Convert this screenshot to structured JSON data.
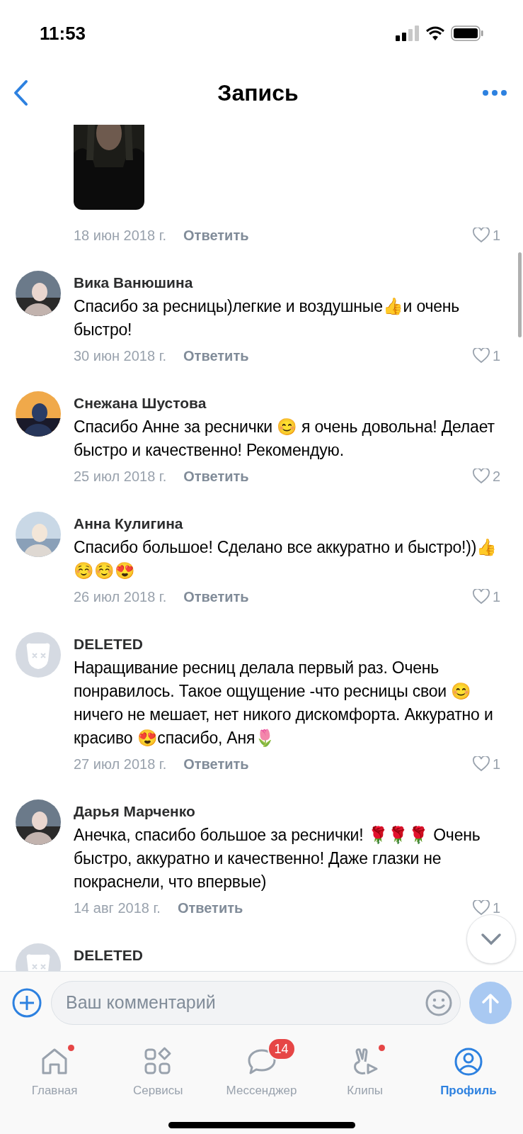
{
  "status_bar": {
    "time": "11:53"
  },
  "header": {
    "title": "Запись"
  },
  "top_comment": {
    "date": "18 июн 2018 г.",
    "reply": "Ответить",
    "likes": "1"
  },
  "comments": [
    {
      "author": "Вика Ванюшина",
      "deleted": false,
      "text": "Спасибо за ресницы)легкие и воздушные👍и очень быстро!",
      "date": "30 июн 2018 г.",
      "reply": "Ответить",
      "likes": "1"
    },
    {
      "author": "Снежана Шустова",
      "deleted": false,
      "text": "Спасибо Анне за реснички 😊 я очень довольна! Делает быстро и качественно!  Рекомендую.",
      "date": "25 июл 2018 г.",
      "reply": "Ответить",
      "likes": "2"
    },
    {
      "author": "Анна Кулигина",
      "deleted": false,
      "text": "Спасибо большое! Сделано все аккуратно и быстро!))👍☺️☺️😍",
      "date": "26 июл 2018 г.",
      "reply": "Ответить",
      "likes": "1"
    },
    {
      "author": "DELETED",
      "deleted": true,
      "text": "Наращивание ресниц делала первый раз. Очень понравилось. Такое ощущение -что ресницы свои 😊ничего не мешает, нет никого дискомфорта. Аккуратно и красиво 😍спасибо, Аня🌷",
      "date": "27 июл 2018 г.",
      "reply": "Ответить",
      "likes": "1"
    },
    {
      "author": "Дарья Марченко",
      "deleted": false,
      "text": "Анечка, спасибо большое за реснички! 🌹🌹🌹 Очень быстро, аккуратно и качественно! Даже глазки не покраснели, что впервые)",
      "date": "14 авг 2018 г.",
      "reply": "Ответить",
      "likes": "1"
    },
    {
      "author": "DELETED",
      "deleted": true
    }
  ],
  "composer": {
    "placeholder": "Ваш комментарий"
  },
  "tabs": [
    {
      "label": "Главная",
      "kind": "home",
      "selected": false,
      "dot": true
    },
    {
      "label": "Сервисы",
      "kind": "services",
      "selected": false,
      "dot": false
    },
    {
      "label": "Мессенджер",
      "kind": "messenger",
      "selected": false,
      "dot": false,
      "badge": "14"
    },
    {
      "label": "Клипы",
      "kind": "clips",
      "selected": false,
      "dot": true
    },
    {
      "label": "Профиль",
      "kind": "profile",
      "selected": true,
      "dot": false
    }
  ]
}
